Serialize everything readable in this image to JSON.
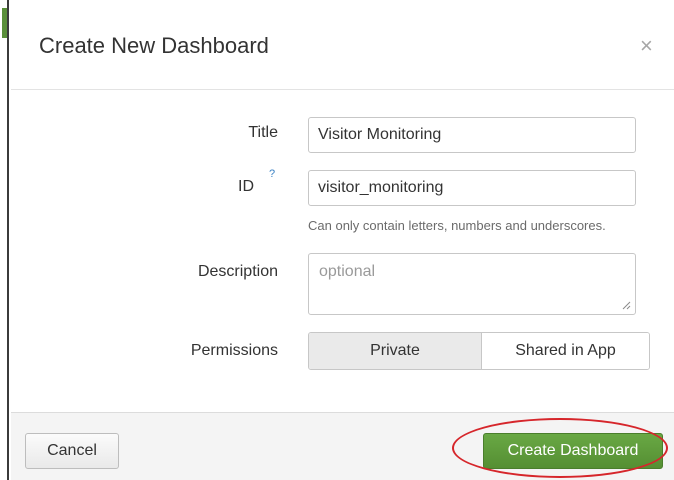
{
  "dialog": {
    "title": "Create New Dashboard",
    "close_glyph": "×"
  },
  "form": {
    "title_label": "Title",
    "title_value": "Visitor Monitoring",
    "id_label": "ID",
    "id_help_glyph": "?",
    "id_value": "visitor_monitoring",
    "id_hint": "Can only contain letters, numbers and underscores.",
    "description_label": "Description",
    "description_placeholder": "optional",
    "permissions_label": "Permissions",
    "permissions_options": [
      "Private",
      "Shared in App"
    ],
    "permissions_selected": "Private"
  },
  "footer": {
    "cancel_label": "Cancel",
    "create_label": "Create Dashboard"
  },
  "colors": {
    "primary_button": "#5f9c3c",
    "annotation_circle": "#d6262b",
    "help_link": "#3b82c4"
  },
  "icons": {
    "close": "close-icon",
    "help": "help-icon",
    "resize": "resize-handle-icon"
  }
}
